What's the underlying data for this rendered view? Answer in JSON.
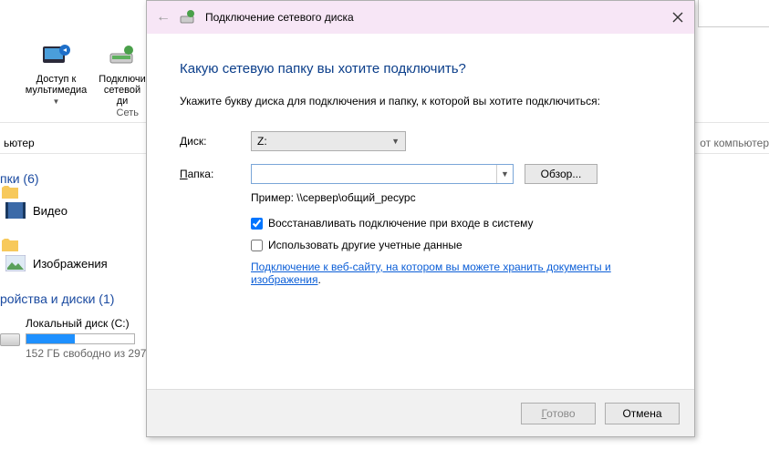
{
  "ribbon": {
    "item1_line1": "Доступ к",
    "item1_line2": "мультимедиа",
    "item2_line1": "Подключи",
    "item2_line2": "сетевой ди",
    "group": "Сеть"
  },
  "breadcrumb": "ьютер",
  "bread_right": "от компьютер",
  "sections": {
    "folders": "пки (6)",
    "devices": "ройства и диски (1)"
  },
  "folders": {
    "videos": "Видео",
    "images": "Изображения"
  },
  "disk": {
    "name": "Локальный диск (C:)",
    "free": "152 ГБ свободно из 297"
  },
  "dialog": {
    "title": "Подключение сетевого диска",
    "heading": "Какую сетевую папку вы хотите подключить?",
    "instruction": "Укажите букву диска для подключения и папку, к которой вы хотите подключиться:",
    "drive_label_pre": "Д",
    "drive_label_post": "иск:",
    "drive_value": "Z:",
    "folder_label_pre": "П",
    "folder_label_post": "апка:",
    "folder_value": "",
    "browse": "Обзор...",
    "example": "Пример: \\\\сервер\\общий_ресурс",
    "cb_reconnect": "Восстанавливать подключение при входе в систему",
    "cb_othercreds": "Использовать другие учетные данные",
    "link": "Подключение к веб-сайту, на котором вы можете хранить документы и изображения",
    "finish": "Готово",
    "cancel": "Отмена"
  }
}
